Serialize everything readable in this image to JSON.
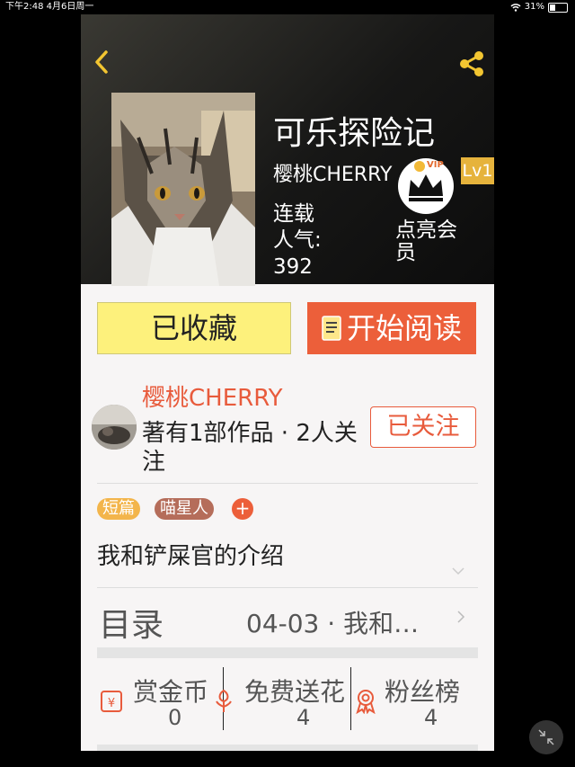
{
  "status_bar": {
    "time": "下午2:48",
    "date": "4月6日周一",
    "battery": "31%"
  },
  "book": {
    "title": "可乐探险记",
    "author": "樱桃CHERRY",
    "level": "Lv1",
    "vip_label": "VIP",
    "status": "连载",
    "popularity": "人气: 392",
    "member_cta": "点亮会员"
  },
  "actions": {
    "favorite": "已收藏",
    "read": "开始阅读"
  },
  "author_card": {
    "name": "樱桃CHERRY",
    "info": "著有1部作品 · 2人关注",
    "follow": "已关注"
  },
  "tags": [
    "短篇",
    "喵星人"
  ],
  "tag_add": "+",
  "intro": "我和铲屎官的介绍",
  "toc": {
    "label": "目录",
    "latest": "04-03 · 我和…"
  },
  "stats": [
    {
      "label": "赏金币",
      "value": "0",
      "icon": "coin-icon"
    },
    {
      "label": "免费送花",
      "value": "4",
      "icon": "flower-icon"
    },
    {
      "label": "粉丝榜",
      "value": "4",
      "icon": "medal-icon"
    }
  ],
  "colors": {
    "accent": "#ec5f3a",
    "favorite_bg": "#fdf17c",
    "lv_badge": "#e6b33c"
  }
}
